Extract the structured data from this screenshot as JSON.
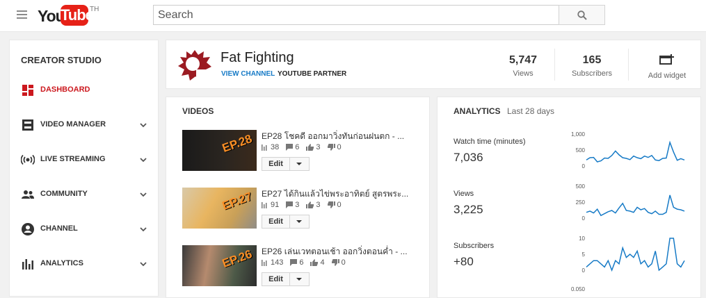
{
  "header": {
    "logo_you": "You",
    "logo_tube": "Tube",
    "logo_region": "TH",
    "search_placeholder": "Search"
  },
  "sidebar": {
    "title": "CREATOR STUDIO",
    "items": [
      {
        "label": "DASHBOARD",
        "icon": "dashboard-icon",
        "active": true
      },
      {
        "label": "VIDEO MANAGER",
        "icon": "video-manager-icon"
      },
      {
        "label": "LIVE STREAMING",
        "icon": "live-streaming-icon"
      },
      {
        "label": "COMMUNITY",
        "icon": "community-icon"
      },
      {
        "label": "CHANNEL",
        "icon": "channel-icon"
      },
      {
        "label": "ANALYTICS",
        "icon": "analytics-icon"
      }
    ]
  },
  "channel": {
    "name": "Fat Fighting",
    "view_channel": "VIEW CHANNEL",
    "partner": "YOUTUBE PARTNER",
    "views": "5,747",
    "views_label": "Views",
    "subscribers": "165",
    "subscribers_label": "Subscribers",
    "add_widget": "Add widget"
  },
  "videos": {
    "title": "VIDEOS",
    "edit_label": "Edit",
    "items": [
      {
        "title": "EP28 โชคดี ออกมาวิ่งทันก่อนฝนตก - ...",
        "views": "38",
        "comments": "6",
        "likes": "3",
        "dislikes": "0",
        "thumb_text": "EP.28"
      },
      {
        "title": "EP27 ได้กินแล้วไข่พระอาทิตย์ สูตรพระ...",
        "views": "91",
        "comments": "3",
        "likes": "3",
        "dislikes": "0",
        "thumb_text": "EP.27"
      },
      {
        "title": "EP26 เล่นเวทตอนเช้า ออกวิ่งตอนค่ำ - ...",
        "views": "143",
        "comments": "6",
        "likes": "4",
        "dislikes": "0",
        "thumb_text": "EP.26"
      }
    ]
  },
  "analytics": {
    "title": "ANALYTICS",
    "range": "Last 28 days",
    "metrics": [
      {
        "label": "Watch time (minutes)",
        "value": "7,036",
        "ticks": [
          "1,000",
          "500",
          "0"
        ],
        "ymax": 1000,
        "series": [
          190,
          260,
          270,
          130,
          160,
          250,
          240,
          330,
          470,
          350,
          260,
          240,
          200,
          310,
          260,
          230,
          310,
          270,
          330,
          190,
          170,
          240,
          250,
          740,
          440,
          180,
          230,
          190
        ]
      },
      {
        "label": "Views",
        "value": "3,225",
        "ticks": [
          "500",
          "250",
          "0"
        ],
        "ymax": 500,
        "series": [
          90,
          110,
          80,
          140,
          40,
          70,
          100,
          120,
          80,
          160,
          230,
          120,
          110,
          90,
          170,
          130,
          150,
          90,
          70,
          110,
          60,
          60,
          90,
          360,
          170,
          140,
          130,
          110
        ]
      },
      {
        "label": "Subscribers",
        "value": "+80",
        "ticks": [
          "10",
          "5",
          "0"
        ],
        "ymax": 10,
        "series": [
          1,
          2,
          3,
          3,
          2,
          1,
          3,
          0,
          3,
          2,
          7,
          4,
          5,
          4,
          6,
          2,
          3,
          1,
          2,
          6,
          0,
          1,
          2,
          10,
          10,
          2,
          1,
          3
        ]
      }
    ],
    "next_tick": "0.050"
  },
  "colors": {
    "accent": "#cc181e",
    "link": "#167ac6",
    "spark": "#167ac6",
    "logo_red": "#e62117"
  }
}
